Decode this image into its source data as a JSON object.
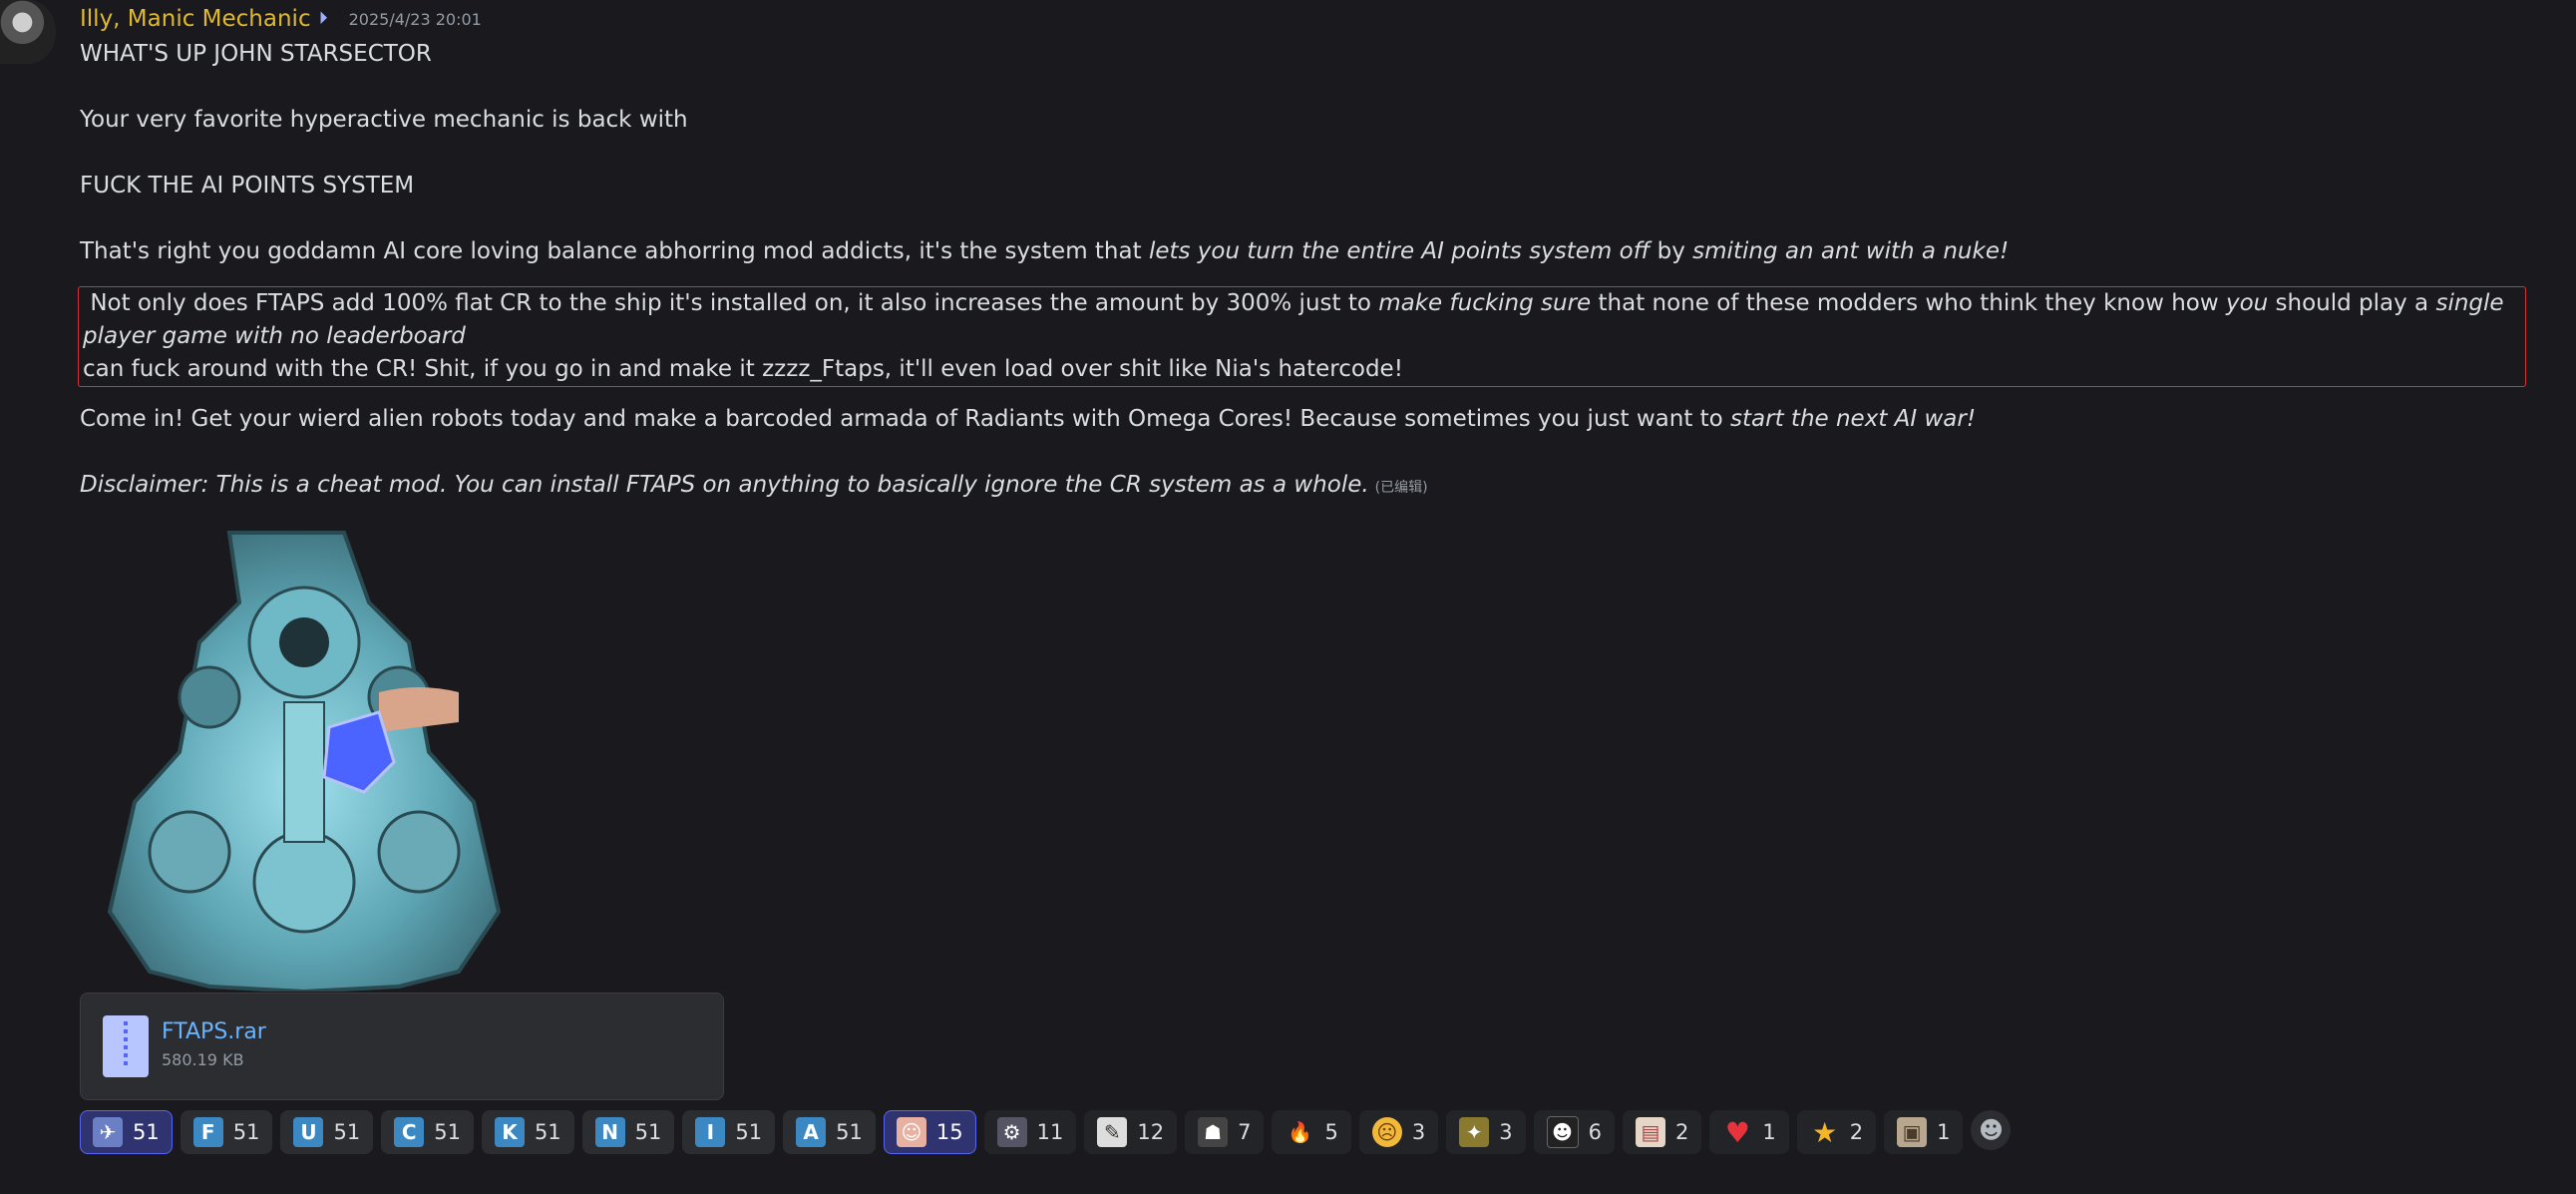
{
  "author": "Illy, Manic Mechanic",
  "timestamp": "2025/4/23 20:01",
  "lines": {
    "l1": "WHAT'S UP JOHN STARSECTOR",
    "l2": "Your very favorite hyperactive mechanic is back with",
    "l3": "FUCK THE AI POINTS SYSTEM",
    "l4a": "That's right you goddamn AI core loving balance abhorring mod addicts, it's the system that ",
    "l4b": "lets you turn the entire AI points system off",
    "l4c": " by ",
    "l4d": "smiting an ant with a nuke!",
    "q1a": " Not only does FTAPS add 100% flat CR to the ship it's installed on, it also increases the amount by 300% just to ",
    "q1b": "make fucking sure",
    "q1c": " that none of these modders who think they know how ",
    "q1d": "you",
    "q1e": " should play a ",
    "q1f": "single player game with no leaderboard",
    "q2": "can fuck around with the CR! Shit, if you go in and make it zzzz_Ftaps, it'll even load over shit like Nia's hatercode!",
    "l5a": "Come in! Get your wierd alien robots today and make a barcoded armada of Radiants with Omega Cores! Because sometimes you just want to ",
    "l5b": "start the next AI war!",
    "l6": "Disclaimer: This is a cheat mod. You can install FTAPS on anything to basically ignore the CR system as a whole.",
    "edited": "(已编辑)"
  },
  "attachment": {
    "name": "FTAPS.rar",
    "size": "580.19 KB"
  },
  "reactions": [
    {
      "emoji": "ship-emoji",
      "count": "51",
      "active": true
    },
    {
      "emoji": "F",
      "count": "51"
    },
    {
      "emoji": "U",
      "count": "51"
    },
    {
      "emoji": "C",
      "count": "51"
    },
    {
      "emoji": "K",
      "count": "51"
    },
    {
      "emoji": "N",
      "count": "51"
    },
    {
      "emoji": "I",
      "count": "51"
    },
    {
      "emoji": "A",
      "count": "51"
    },
    {
      "emoji": "anime-girl-emoji",
      "count": "15",
      "active": true
    },
    {
      "emoji": "mech-emoji",
      "count": "11"
    },
    {
      "emoji": "sketch-emoji",
      "count": "12"
    },
    {
      "emoji": "figure-emoji",
      "count": "7"
    },
    {
      "emoji": "fire-emoji",
      "count": "5"
    },
    {
      "emoji": "face-emoji",
      "count": "3"
    },
    {
      "emoji": "spaceship-emoji",
      "count": "3"
    },
    {
      "emoji": "portrait-emoji",
      "count": "6"
    },
    {
      "emoji": "paper-emoji",
      "count": "2"
    },
    {
      "emoji": "heart-emoji",
      "count": "1"
    },
    {
      "emoji": "star-emoji",
      "count": "2"
    },
    {
      "emoji": "photo-emoji",
      "count": "1"
    }
  ]
}
